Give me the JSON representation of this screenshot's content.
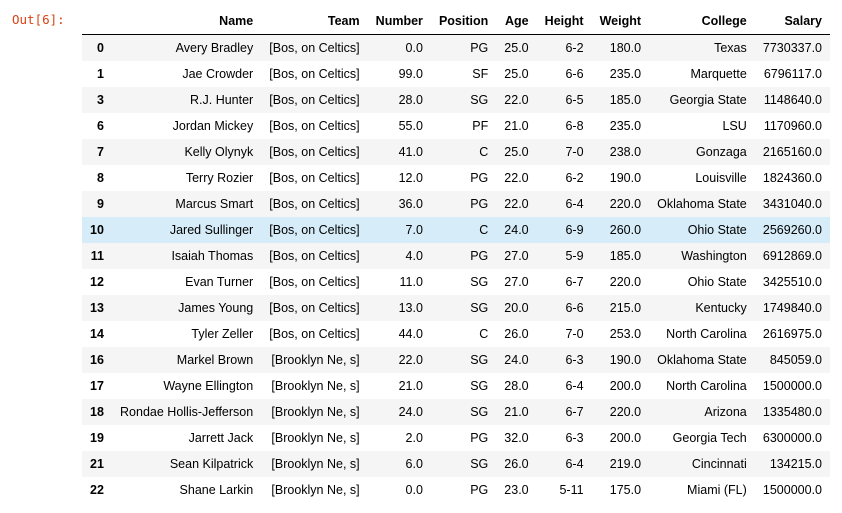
{
  "prompt": "Out[6]:",
  "columns": [
    "",
    "Name",
    "Team",
    "Number",
    "Position",
    "Age",
    "Height",
    "Weight",
    "College",
    "Salary"
  ],
  "highlight_index": 7,
  "rows": [
    {
      "idx": "0",
      "Name": "Avery Bradley",
      "Team": "[Bos, on Celtics]",
      "Number": "0.0",
      "Position": "PG",
      "Age": "25.0",
      "Height": "6-2",
      "Weight": "180.0",
      "College": "Texas",
      "Salary": "7730337.0"
    },
    {
      "idx": "1",
      "Name": "Jae Crowder",
      "Team": "[Bos, on Celtics]",
      "Number": "99.0",
      "Position": "SF",
      "Age": "25.0",
      "Height": "6-6",
      "Weight": "235.0",
      "College": "Marquette",
      "Salary": "6796117.0"
    },
    {
      "idx": "3",
      "Name": "R.J. Hunter",
      "Team": "[Bos, on Celtics]",
      "Number": "28.0",
      "Position": "SG",
      "Age": "22.0",
      "Height": "6-5",
      "Weight": "185.0",
      "College": "Georgia State",
      "Salary": "1148640.0"
    },
    {
      "idx": "6",
      "Name": "Jordan Mickey",
      "Team": "[Bos, on Celtics]",
      "Number": "55.0",
      "Position": "PF",
      "Age": "21.0",
      "Height": "6-8",
      "Weight": "235.0",
      "College": "LSU",
      "Salary": "1170960.0"
    },
    {
      "idx": "7",
      "Name": "Kelly Olynyk",
      "Team": "[Bos, on Celtics]",
      "Number": "41.0",
      "Position": "C",
      "Age": "25.0",
      "Height": "7-0",
      "Weight": "238.0",
      "College": "Gonzaga",
      "Salary": "2165160.0"
    },
    {
      "idx": "8",
      "Name": "Terry Rozier",
      "Team": "[Bos, on Celtics]",
      "Number": "12.0",
      "Position": "PG",
      "Age": "22.0",
      "Height": "6-2",
      "Weight": "190.0",
      "College": "Louisville",
      "Salary": "1824360.0"
    },
    {
      "idx": "9",
      "Name": "Marcus Smart",
      "Team": "[Bos, on Celtics]",
      "Number": "36.0",
      "Position": "PG",
      "Age": "22.0",
      "Height": "6-4",
      "Weight": "220.0",
      "College": "Oklahoma State",
      "Salary": "3431040.0"
    },
    {
      "idx": "10",
      "Name": "Jared Sullinger",
      "Team": "[Bos, on Celtics]",
      "Number": "7.0",
      "Position": "C",
      "Age": "24.0",
      "Height": "6-9",
      "Weight": "260.0",
      "College": "Ohio State",
      "Salary": "2569260.0"
    },
    {
      "idx": "11",
      "Name": "Isaiah Thomas",
      "Team": "[Bos, on Celtics]",
      "Number": "4.0",
      "Position": "PG",
      "Age": "27.0",
      "Height": "5-9",
      "Weight": "185.0",
      "College": "Washington",
      "Salary": "6912869.0"
    },
    {
      "idx": "12",
      "Name": "Evan Turner",
      "Team": "[Bos, on Celtics]",
      "Number": "11.0",
      "Position": "SG",
      "Age": "27.0",
      "Height": "6-7",
      "Weight": "220.0",
      "College": "Ohio State",
      "Salary": "3425510.0"
    },
    {
      "idx": "13",
      "Name": "James Young",
      "Team": "[Bos, on Celtics]",
      "Number": "13.0",
      "Position": "SG",
      "Age": "20.0",
      "Height": "6-6",
      "Weight": "215.0",
      "College": "Kentucky",
      "Salary": "1749840.0"
    },
    {
      "idx": "14",
      "Name": "Tyler Zeller",
      "Team": "[Bos, on Celtics]",
      "Number": "44.0",
      "Position": "C",
      "Age": "26.0",
      "Height": "7-0",
      "Weight": "253.0",
      "College": "North Carolina",
      "Salary": "2616975.0"
    },
    {
      "idx": "16",
      "Name": "Markel Brown",
      "Team": "[Brooklyn Ne, s]",
      "Number": "22.0",
      "Position": "SG",
      "Age": "24.0",
      "Height": "6-3",
      "Weight": "190.0",
      "College": "Oklahoma State",
      "Salary": "845059.0"
    },
    {
      "idx": "17",
      "Name": "Wayne Ellington",
      "Team": "[Brooklyn Ne, s]",
      "Number": "21.0",
      "Position": "SG",
      "Age": "28.0",
      "Height": "6-4",
      "Weight": "200.0",
      "College": "North Carolina",
      "Salary": "1500000.0"
    },
    {
      "idx": "18",
      "Name": "Rondae Hollis-Jefferson",
      "Team": "[Brooklyn Ne, s]",
      "Number": "24.0",
      "Position": "SG",
      "Age": "21.0",
      "Height": "6-7",
      "Weight": "220.0",
      "College": "Arizona",
      "Salary": "1335480.0"
    },
    {
      "idx": "19",
      "Name": "Jarrett Jack",
      "Team": "[Brooklyn Ne, s]",
      "Number": "2.0",
      "Position": "PG",
      "Age": "32.0",
      "Height": "6-3",
      "Weight": "200.0",
      "College": "Georgia Tech",
      "Salary": "6300000.0"
    },
    {
      "idx": "21",
      "Name": "Sean Kilpatrick",
      "Team": "[Brooklyn Ne, s]",
      "Number": "6.0",
      "Position": "SG",
      "Age": "26.0",
      "Height": "6-4",
      "Weight": "219.0",
      "College": "Cincinnati",
      "Salary": "134215.0"
    },
    {
      "idx": "22",
      "Name": "Shane Larkin",
      "Team": "[Brooklyn Ne, s]",
      "Number": "0.0",
      "Position": "PG",
      "Age": "23.0",
      "Height": "5-11",
      "Weight": "175.0",
      "College": "Miami (FL)",
      "Salary": "1500000.0"
    }
  ]
}
